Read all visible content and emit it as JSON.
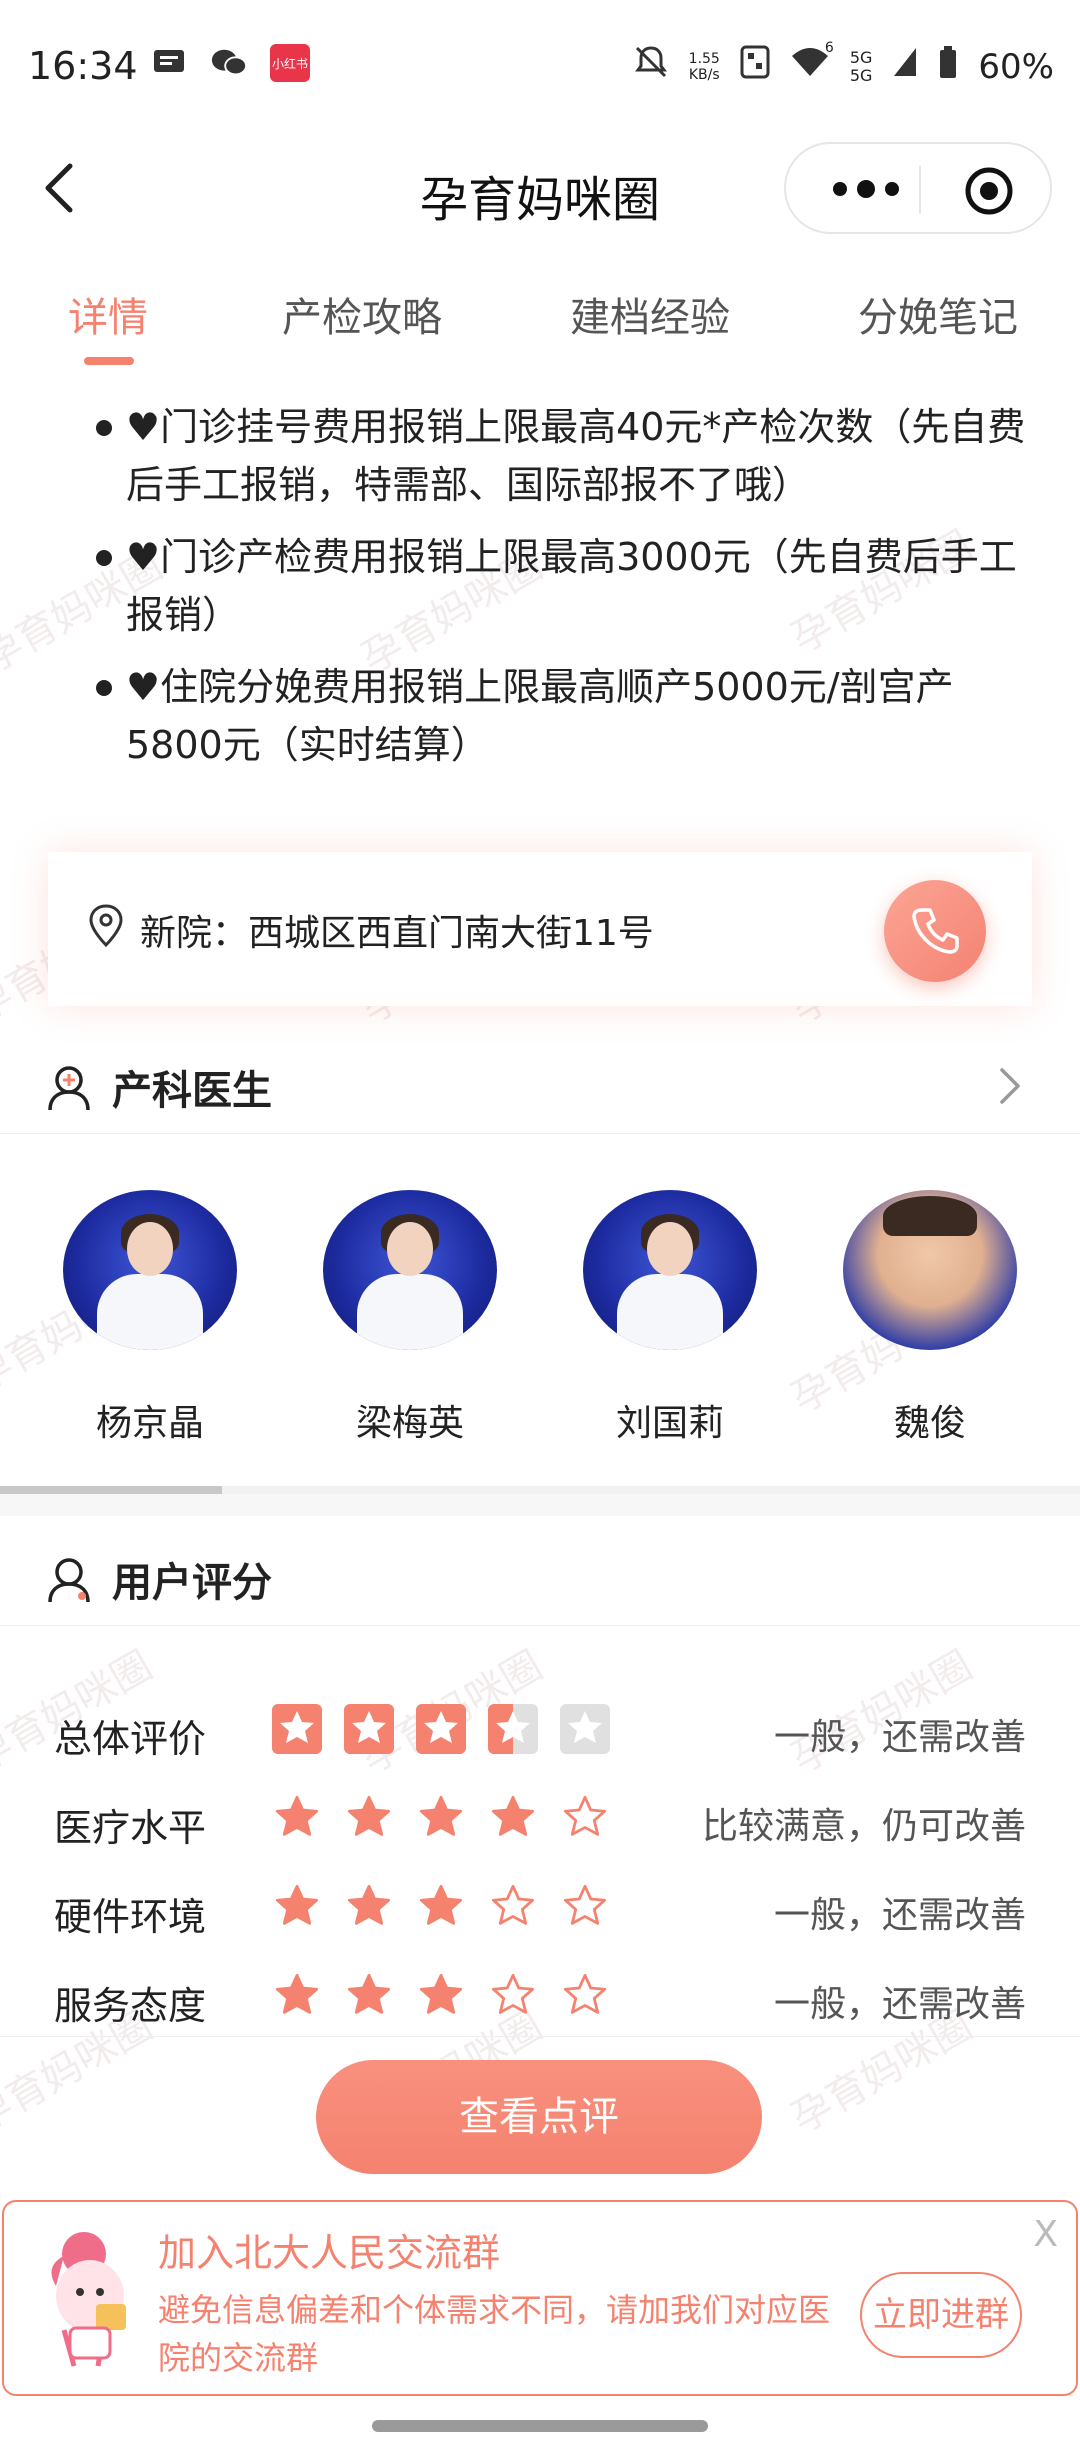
{
  "status_bar": {
    "time": "16:34",
    "net_speed": "1.55",
    "net_unit": "KB/s",
    "battery": "60%",
    "app_badge": "小红书",
    "signal_5g_a": "5G",
    "signal_5g_b": "5G",
    "wifi_num": "6"
  },
  "header": {
    "title": "孕育妈咪圈"
  },
  "tabs": [
    {
      "label": "详情",
      "active": true
    },
    {
      "label": "产检攻略",
      "active": false
    },
    {
      "label": "建档经验",
      "active": false
    },
    {
      "label": "分娩笔记",
      "active": false
    }
  ],
  "bullets": [
    "♥门诊挂号费用报销上限最高40元*产检次数（先自费后手工报销，特需部、国际部报不了哦）",
    "♥门诊产检费用报销上限最高3000元（先自费后手工报销）",
    "♥住院分娩费用报销上限最高顺产5000元/剖宫产5800元（实时结算）"
  ],
  "address": {
    "text": "新院：西城区西直门南大街11号"
  },
  "doctors_section": {
    "title": "产科医生",
    "doctors": [
      {
        "name": "杨京晶"
      },
      {
        "name": "梁梅英"
      },
      {
        "name": "刘国莉"
      },
      {
        "name": "魏俊"
      }
    ]
  },
  "ratings_section": {
    "title": "用户评分",
    "rows": [
      {
        "label": "总体评价",
        "rating": 3.5,
        "text": "一般，还需改善"
      },
      {
        "label": "医疗水平",
        "rating": 4,
        "text": "比较满意，仍可改善"
      },
      {
        "label": "硬件环境",
        "rating": 3,
        "text": "一般，还需改善"
      },
      {
        "label": "服务态度",
        "rating": 3,
        "text": "一般，还需改善"
      }
    ]
  },
  "review_button": {
    "label": "查看点评"
  },
  "banner": {
    "title": "加入北大人民交流群",
    "desc": "避免信息偏差和个体需求不同，请加我们对应医院的交流群",
    "join_label": "立即进群",
    "close_label": "X"
  },
  "watermark": "孕育妈咪圈",
  "colors": {
    "accent": "#f4826f",
    "text": "#222222",
    "muted": "#555555"
  }
}
